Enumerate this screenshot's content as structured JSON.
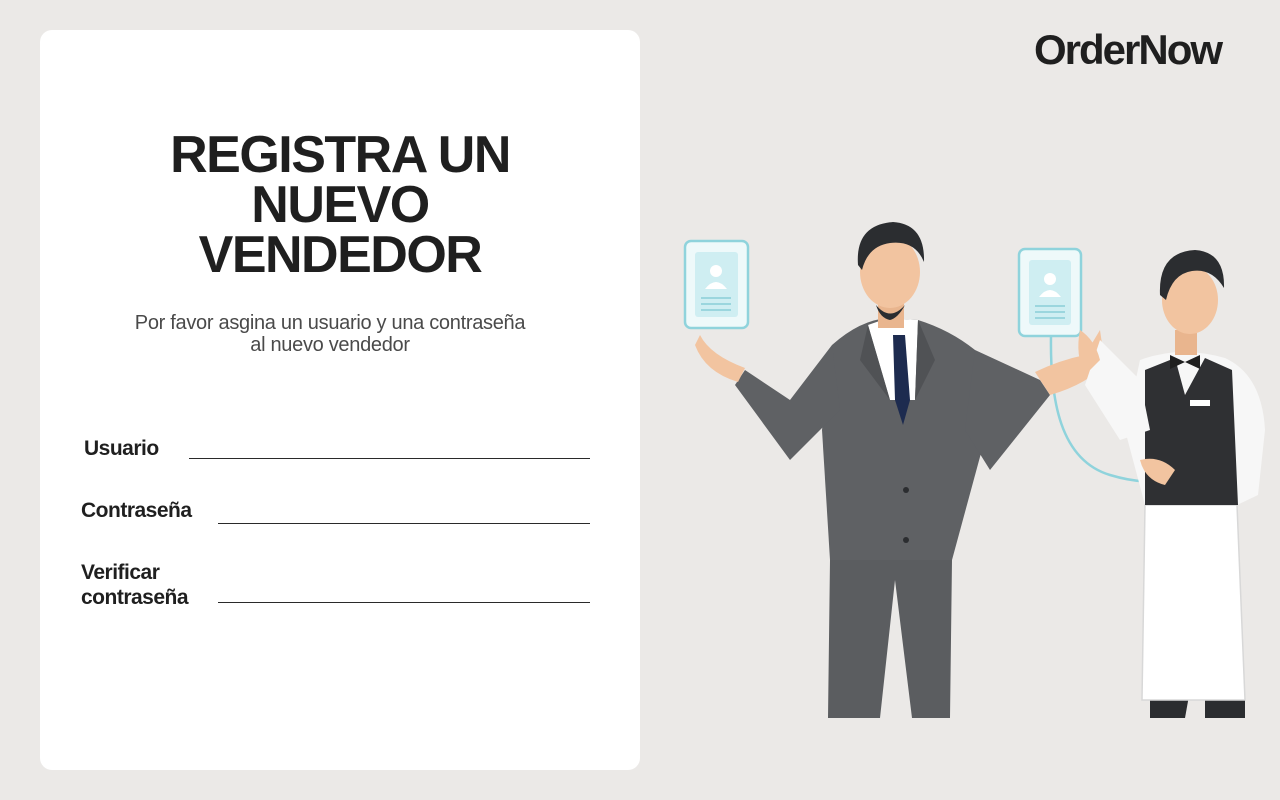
{
  "brand": {
    "logo_text": "OrderNow"
  },
  "form": {
    "title_lines": [
      "REGISTRA UN",
      "NUEVO",
      "VENDEDOR"
    ],
    "subtitle_lines": [
      "Por favor asgina un usuario y una contraseña",
      "al nuevo vendedor"
    ],
    "fields": {
      "usuario": {
        "label": "Usuario",
        "value": ""
      },
      "contrasena": {
        "label": "Contraseña",
        "value": ""
      },
      "verificar": {
        "label_lines": [
          "Verificar",
          "contraseña"
        ],
        "value": ""
      }
    }
  },
  "illustration": {
    "icon": "businessman-and-waiter-id-cards",
    "colors": {
      "suit": "#5b5d60",
      "card_border": "#8fd3dc",
      "card_fill": "#d6f0f3",
      "tie": "#1d2b4f"
    }
  },
  "colors": {
    "background": "#ebe9e7",
    "card": "#ffffff",
    "text": "#1f1f1f",
    "line": "#2a2a2a"
  }
}
